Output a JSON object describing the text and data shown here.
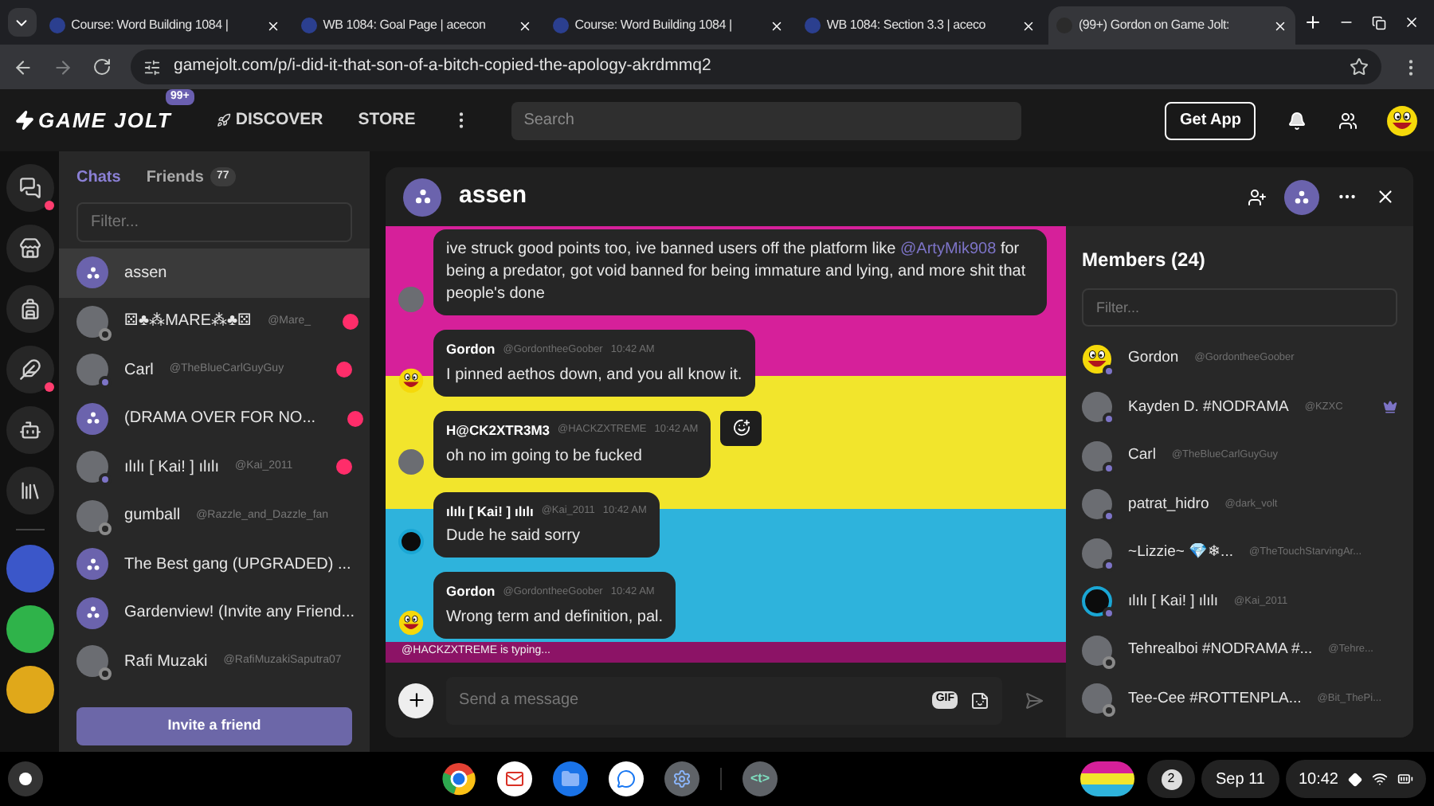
{
  "browser": {
    "tabs": [
      {
        "title": "Course: Word Building 1084 |",
        "selected": false
      },
      {
        "title": "WB 1084: Goal Page | acecon",
        "selected": false
      },
      {
        "title": "Course: Word Building 1084 |",
        "selected": false
      },
      {
        "title": "WB 1084: Section 3.3 | aceco",
        "selected": false
      },
      {
        "title": "(99+) Gordon on Game Jolt:",
        "selected": true
      }
    ],
    "address": "gamejolt.com/p/i-did-it-that-son-of-a-bitch-copied-the-apology-akrdmmq2"
  },
  "site_header": {
    "logo": "GAME JOLT",
    "badge": "99+",
    "nav": [
      "DISCOVER",
      "STORE"
    ],
    "search": {
      "placeholder": "Search"
    },
    "get_app": "Get App"
  },
  "rail": {
    "items": [
      {
        "alert": true
      },
      {
        "alert": false
      },
      {
        "alert": false
      },
      {
        "alert": true
      },
      {
        "alert": false
      },
      {
        "alert": false
      }
    ]
  },
  "chats": {
    "tabs": [
      {
        "label": "Chats",
        "selected": true
      },
      {
        "label": "Friends",
        "count": "77",
        "selected": false
      }
    ],
    "filter": {
      "placeholder": "Filter..."
    },
    "items": [
      {
        "kind": "group",
        "name": "assen",
        "selected": true,
        "unread": false
      },
      {
        "kind": "user",
        "name": "⚄♣⁂MARE⁂♣⚄",
        "handle": "@Mare_",
        "online": false,
        "selected": false,
        "unread": true
      },
      {
        "kind": "user",
        "name": "Carl",
        "handle": "@TheBlueCarlGuyGuy",
        "online": true,
        "selected": false,
        "unread": true
      },
      {
        "kind": "group",
        "name": "(DRAMA OVER FOR NO...",
        "selected": false,
        "unread": true
      },
      {
        "kind": "user",
        "name": "ılılı [ Kai! ] ılılı",
        "handle": "@Kai_2011",
        "online": true,
        "selected": false,
        "unread": true
      },
      {
        "kind": "user",
        "name": "gumball",
        "handle": "@Razzle_and_Dazzle_fan",
        "online": false,
        "selected": false,
        "unread": false
      },
      {
        "kind": "group",
        "name": "The Best gang (UPGRADED) ...",
        "selected": false,
        "unread": false
      },
      {
        "kind": "group",
        "name": "Gardenview! (Invite any Friend...",
        "selected": false,
        "unread": false
      },
      {
        "kind": "user",
        "name": "Rafi Muzaki",
        "handle": "@RafiMuzakiSaputra07",
        "online": false,
        "selected": false,
        "unread": false
      }
    ],
    "invite": "Invite a friend"
  },
  "chat": {
    "title": "assen",
    "messages": [
      {
        "kind": "photo",
        "text": "ive struck good points too, ive banned users off the platform like ",
        "mention": "@ArtyMik908",
        "text_after": " for being a predator, got void banned for being immature and lying, and more shit that people's done",
        "hovered": false
      },
      {
        "kind": "smiley",
        "author": "Gordon",
        "handle": "@GordontheeGoober",
        "time": "10:42 AM",
        "text": "I pinned aethos down, and you all know it.",
        "hovered": false
      },
      {
        "kind": "photo",
        "author": "H@CK2XTR3M3",
        "handle": "@HACKZXTREME",
        "time": "10:42 AM",
        "text": "oh no im going to be fucked",
        "hovered": true
      },
      {
        "kind": "dark",
        "author": "ılılı [ Kai! ] ılılı",
        "handle": "@Kai_2011",
        "time": "10:42 AM",
        "text": "Dude he said sorry",
        "hovered": false
      },
      {
        "kind": "smiley",
        "author": "Gordon",
        "handle": "@GordontheeGoober",
        "time": "10:42 AM",
        "text": "Wrong term and definition, pal.",
        "hovered": false
      }
    ],
    "typing": "@HACKZXTREME is typing...",
    "composer": {
      "placeholder": "Send a message",
      "gif": "GIF"
    }
  },
  "members": {
    "title": "Members (24)",
    "filter": {
      "placeholder": "Filter..."
    },
    "items": [
      {
        "kind": "smiley",
        "name": "Gordon",
        "handle": "@GordontheeGoober",
        "online": true,
        "owner": false
      },
      {
        "kind": "photo",
        "name": "Kayden D. #NODRAMA",
        "handle": "@KZXC",
        "online": true,
        "owner": true
      },
      {
        "kind": "photo",
        "name": "Carl",
        "handle": "@TheBlueCarlGuyGuy",
        "online": true,
        "owner": false
      },
      {
        "kind": "photo",
        "name": "patrat_hidro",
        "handle": "@dark_volt",
        "online": true,
        "owner": false
      },
      {
        "kind": "photo",
        "name": "~Lizzie~ 💎❄...",
        "handle": "@TheTouchStarvingAr...",
        "online": true,
        "owner": false
      },
      {
        "kind": "dark",
        "name": "ılılı [ Kai! ] ılılı",
        "handle": "@Kai_2011",
        "online": true,
        "owner": false
      },
      {
        "kind": "photo",
        "name": "Tehrealboi #NODRAMA #...",
        "handle": "@Tehre...",
        "online": false,
        "owner": false
      },
      {
        "kind": "photo",
        "name": "Tee-Cee #ROTTENPLA...",
        "handle": "@Bit_ThePi...",
        "online": false,
        "owner": false
      }
    ]
  },
  "shelf": {
    "app_label": "<t>",
    "notifications": "2",
    "date": "Sep 11",
    "time": "10:42"
  }
}
